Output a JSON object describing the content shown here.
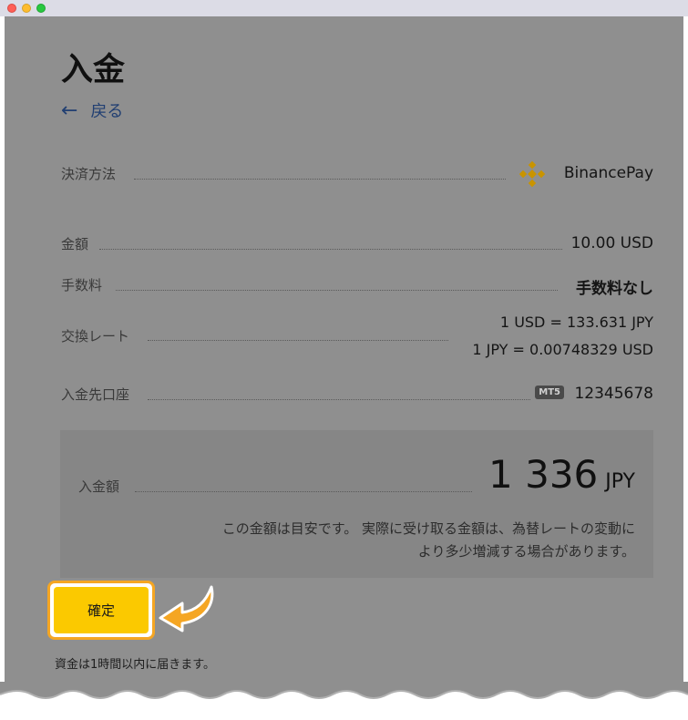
{
  "page": {
    "title": "入金",
    "back_label": "戻る"
  },
  "details": {
    "payment_method": {
      "label": "決済方法",
      "value": "BinancePay",
      "icon": "binance-logo"
    },
    "amount": {
      "label": "金額",
      "value": "10.00 USD"
    },
    "fee": {
      "label": "手数料",
      "value": "手数料なし"
    },
    "exchange_rate": {
      "label": "交換レート",
      "line1": "1 USD = 133.631 JPY",
      "line2": "1 JPY = 0.00748329 USD"
    },
    "account": {
      "label": "入金先口座",
      "badge": "MT5",
      "value": "12345678"
    }
  },
  "summary": {
    "label": "入金額",
    "amount": "1 336",
    "currency": "JPY",
    "note_line1": "この金額は目安です。 実際に受け取る金額は、為替レートの変動に",
    "note_line2": "より多少増減する場合があります。"
  },
  "confirm_button": {
    "label": "確定"
  },
  "footer": {
    "note": "資金は1時間以内に届きます。"
  },
  "colors": {
    "accent": "#fbc900",
    "highlight": "#f5a623",
    "back_link": "#213f72",
    "binance": "#c99400"
  }
}
